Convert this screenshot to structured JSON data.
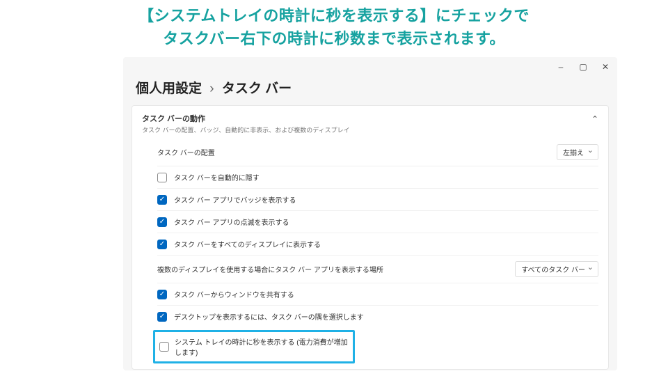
{
  "annotation": {
    "line1": "【システムトレイの時計に秒を表示する】にチェックで",
    "line2": "タスクバー右下の時計に秒数まで表示されます。"
  },
  "window_controls": {
    "min": "–",
    "max": "▢",
    "close": "✕"
  },
  "breadcrumb": {
    "parent": "個人用設定",
    "sep": "›",
    "current": "タスク バー"
  },
  "panel": {
    "title": "タスク バーの動作",
    "subtitle": "タスク バーの配置、バッジ、自動的に非表示、および複数のディスプレイ"
  },
  "rows": {
    "alignment": {
      "label": "タスク バーの配置",
      "value": "左揃え"
    },
    "autohide": {
      "label": "タスク バーを自動的に隠す",
      "checked": false
    },
    "badges": {
      "label": "タスク バー アプリでバッジを表示する",
      "checked": true
    },
    "flashing": {
      "label": "タスク バー アプリの点滅を表示する",
      "checked": true
    },
    "all_displays": {
      "label": "タスク バーをすべてのディスプレイに表示する",
      "checked": true
    },
    "multi_display_where": {
      "label": "複数のディスプレイを使用する場合にタスク バー アプリを表示する場所",
      "value": "すべてのタスク バー"
    },
    "share_window": {
      "label": "タスク バーからウィンドウを共有する",
      "checked": true
    },
    "show_desktop": {
      "label": "デスクトップを表示するには、タスク バーの隅を選択します",
      "checked": true
    },
    "show_seconds": {
      "label": "システム トレイの時計に秒を表示する (電力消費が増加します)",
      "checked": false
    }
  }
}
